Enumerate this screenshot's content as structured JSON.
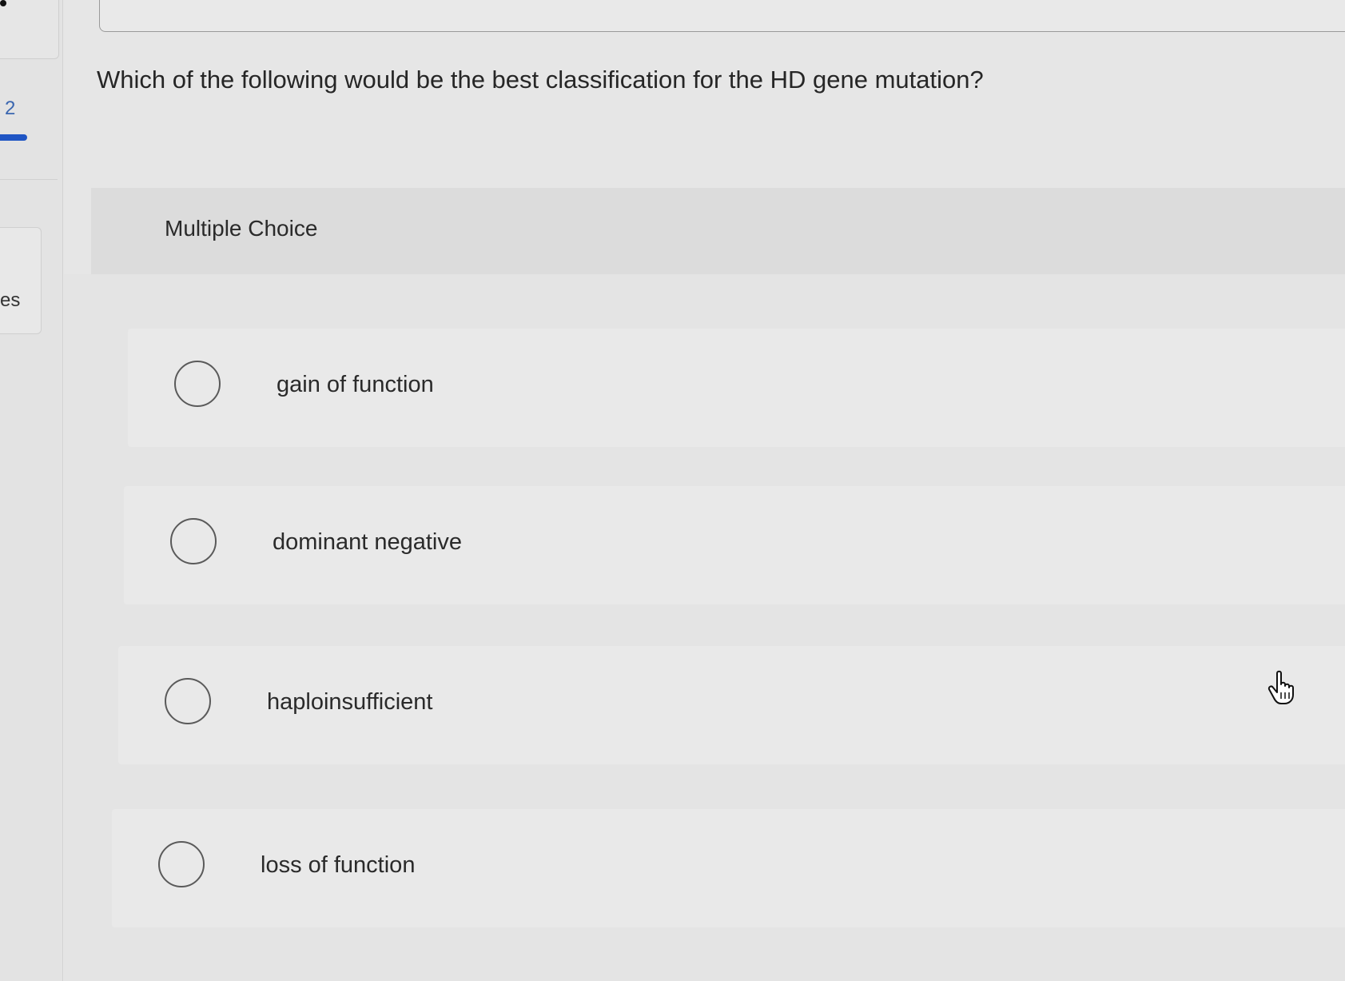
{
  "sidebar": {
    "question_number": "2",
    "label_fragment": "es"
  },
  "question": {
    "text": "Which of the following would be the best classification for the HD gene mutation?"
  },
  "answer_section": {
    "type_label": "Multiple Choice",
    "choices": [
      {
        "label": "gain of function",
        "selected": false
      },
      {
        "label": "dominant negative",
        "selected": false
      },
      {
        "label": "haploinsufficient",
        "selected": false
      },
      {
        "label": "loss of function",
        "selected": false
      }
    ]
  },
  "cursor": {
    "icon": "hand-pointer-icon"
  }
}
